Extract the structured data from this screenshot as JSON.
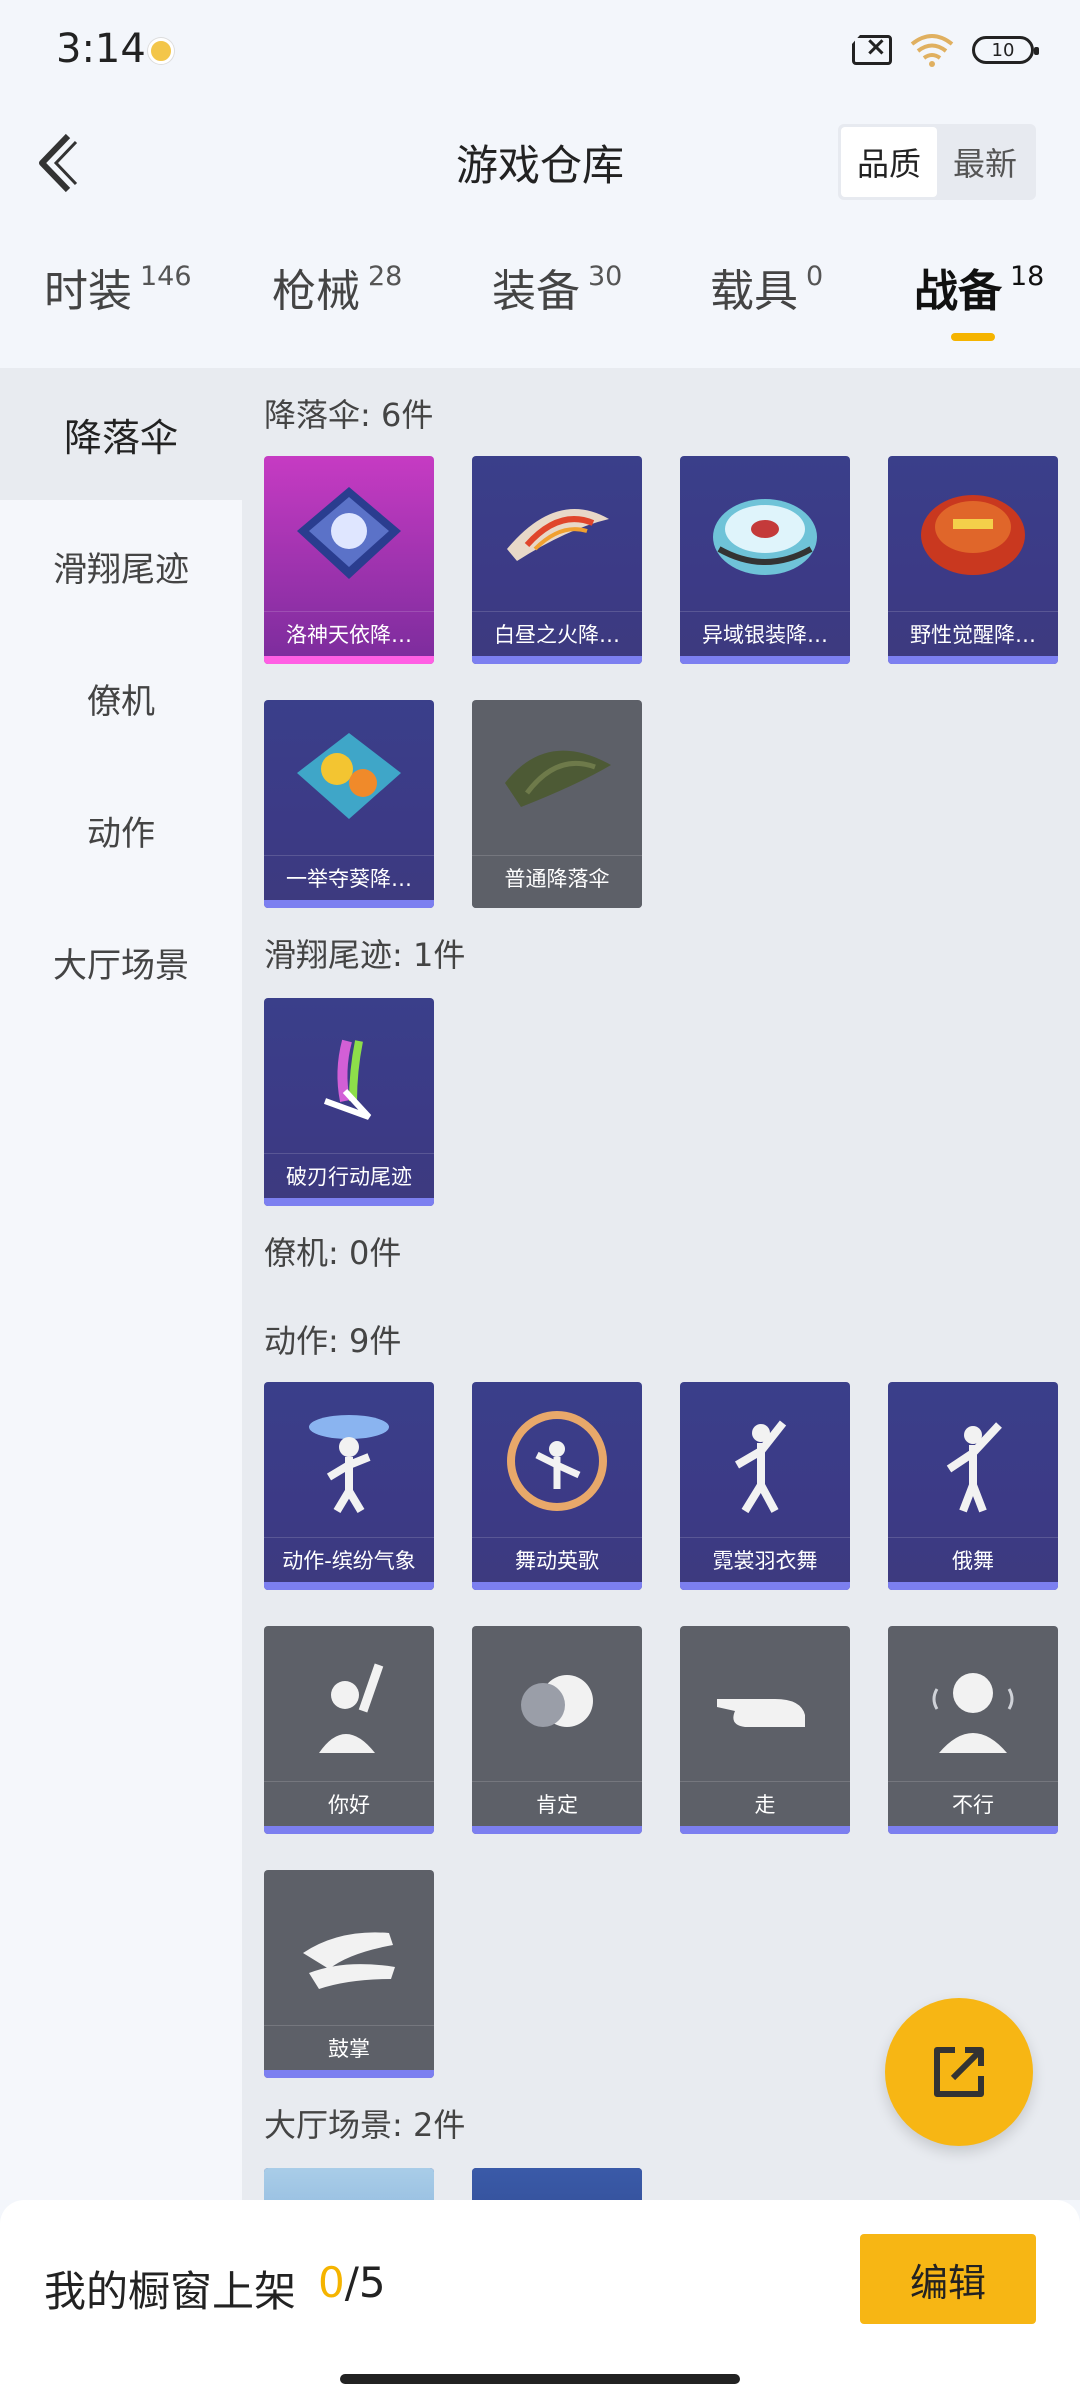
{
  "status": {
    "time": "3:14",
    "battery": "10"
  },
  "header": {
    "title": "游戏仓库",
    "sort_options": [
      "品质",
      "最新"
    ]
  },
  "tabs": [
    {
      "label": "时装",
      "count": "146"
    },
    {
      "label": "枪械",
      "count": "28"
    },
    {
      "label": "装备",
      "count": "30"
    },
    {
      "label": "载具",
      "count": "0"
    },
    {
      "label": "战备",
      "count": "18"
    }
  ],
  "sidebar": [
    "降落伞",
    "滑翔尾迹",
    "僚机",
    "动作",
    "大厅场景"
  ],
  "sections": {
    "parachute": {
      "title": "降落伞: 6件",
      "items": [
        "洛神天依降…",
        "白昼之火降…",
        "异域银装降…",
        "野性觉醒降…",
        "一举夺葵降…",
        "普通降落伞"
      ]
    },
    "trail": {
      "title": "滑翔尾迹: 1件",
      "items": [
        "破刃行动尾迹"
      ]
    },
    "wingman": {
      "title": "僚机: 0件"
    },
    "emote": {
      "title": "动作: 9件",
      "items": [
        "动作-缤纷气象",
        "舞动英歌",
        "霓裳羽衣舞",
        "俄舞",
        "你好",
        "肯定",
        "走",
        "不行",
        "鼓掌"
      ]
    },
    "lobby": {
      "title": "大厅场景: 2件"
    }
  },
  "bottom": {
    "label": "我的橱窗上架",
    "current": "0",
    "total": "/5",
    "edit": "编辑"
  }
}
